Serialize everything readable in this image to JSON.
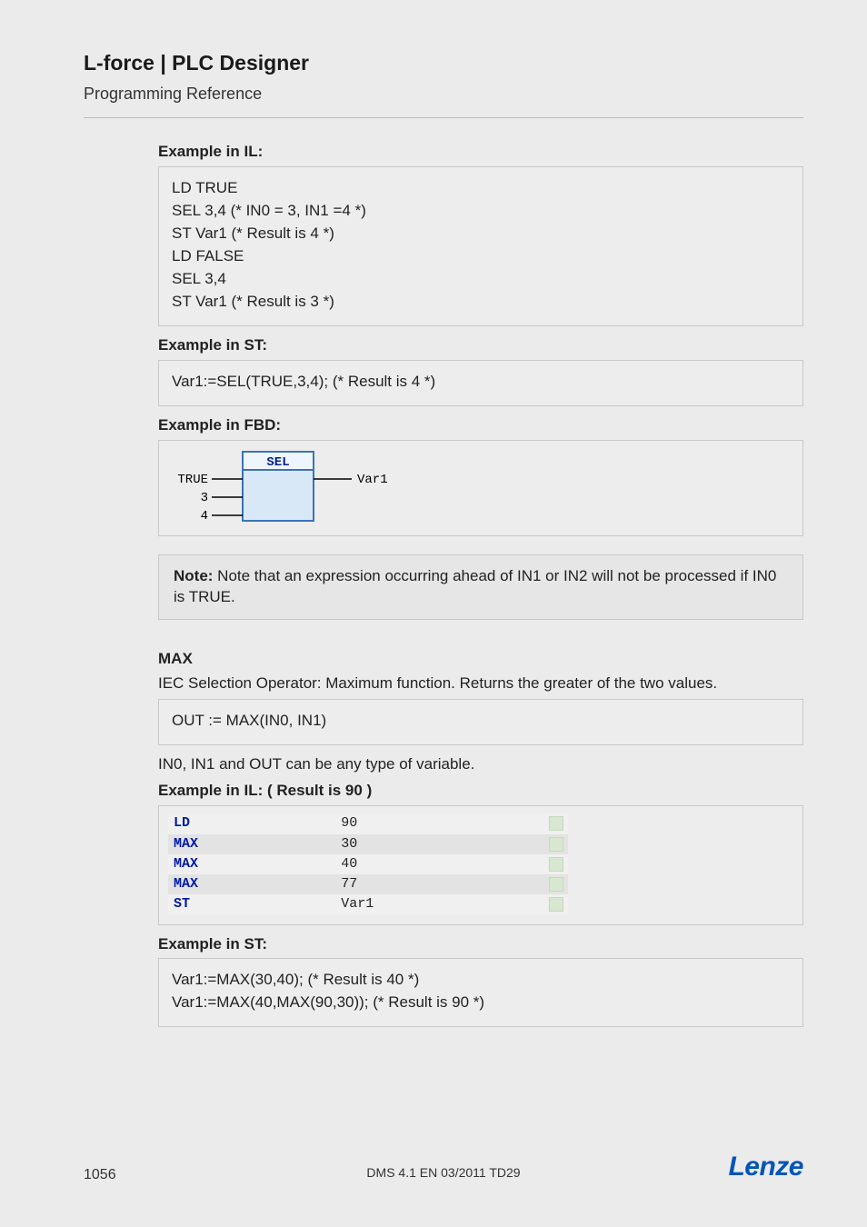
{
  "header": {
    "title": "L-force | PLC Designer",
    "subtitle": "Programming Reference"
  },
  "sel": {
    "il_label": "Example in IL:",
    "il_lines": [
      "LD  TRUE",
      "SEL 3,4   (* IN0 = 3, IN1 =4 *)",
      "ST  Var1  (* Result is 4 *)",
      "LD  FALSE",
      "SEL 3,4",
      "ST  Var1  (* Result is 3 *)"
    ],
    "st_label": "Example in ST:",
    "st_line": "Var1:=SEL(TRUE,3,4); (* Result is 4 *)",
    "fbd_label": "Example in FBD:",
    "fbd": {
      "block": "SEL",
      "in0": "TRUE",
      "in1": "3",
      "in2": "4",
      "out": "Var1"
    },
    "note_lead": "Note:",
    "note_body": " Note that an expression occurring ahead of IN1 or IN2 will not be processed if IN0 is TRUE."
  },
  "max": {
    "head": "MAX",
    "desc": "IEC Selection Operator: Maximum function. Returns the greater of the two values.",
    "sig": "OUT := MAX(IN0, IN1)",
    "types": "IN0, IN1 and OUT can be any type of variable.",
    "il_label": "Example in IL: ( Result is 90 )",
    "il_rows": [
      {
        "op": "LD",
        "arg": "90"
      },
      {
        "op": "MAX",
        "arg": "30"
      },
      {
        "op": "MAX",
        "arg": "40"
      },
      {
        "op": "MAX",
        "arg": "77"
      },
      {
        "op": "ST",
        "arg": "Var1"
      }
    ],
    "st_label": "Example in ST:",
    "st_lines": [
      "Var1:=MAX(30,40); (* Result is 40 *)",
      "Var1:=MAX(40,MAX(90,30)); (* Result is 90 *)"
    ]
  },
  "footer": {
    "page": "1056",
    "center": "DMS 4.1 EN 03/2011 TD29",
    "logo": "Lenze"
  }
}
